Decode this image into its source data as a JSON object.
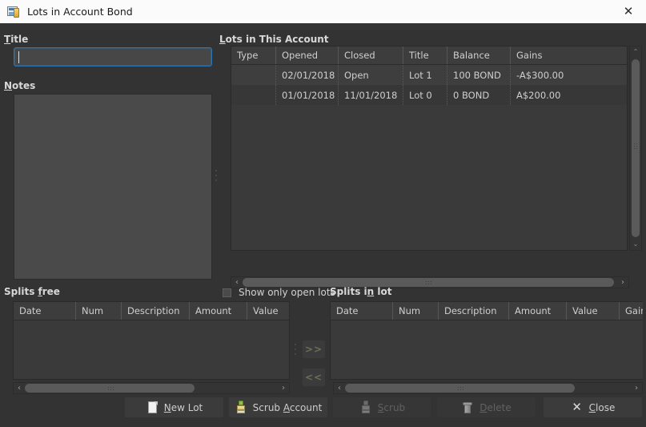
{
  "window": {
    "title": "Lots in Account Bond",
    "icon": "account-lots-icon",
    "close_label": "✕"
  },
  "left_panel": {
    "title_label": "Title",
    "title_label_accel": "T",
    "title_value": "",
    "title_placeholder": "",
    "notes_label": "Notes",
    "notes_label_accel": "N",
    "notes_value": ""
  },
  "lots_panel": {
    "label": "Lots in This Account",
    "label_accel": "L",
    "columns": [
      "Type",
      "Opened",
      "Closed",
      "Title",
      "Balance",
      "Gains"
    ],
    "rows": [
      {
        "type": "",
        "opened": "02/01/2018",
        "closed": "Open",
        "title": "Lot 1",
        "balance": "100 BOND",
        "gains": "-A$300.00"
      },
      {
        "type": "",
        "opened": "01/01/2018",
        "closed": "11/01/2018",
        "title": "Lot 0",
        "balance": "0 BOND",
        "gains": "A$200.00"
      }
    ],
    "show_only_open_lots_label": "Show only open lots",
    "show_only_open_lots_checked": false,
    "scroll_up_glyph": "⌃",
    "scroll_down_glyph": "⌄",
    "scroll_left_glyph": "‹",
    "scroll_right_glyph": "›"
  },
  "splits_free": {
    "label": "Splits free",
    "label_accel": "f",
    "columns": [
      "Date",
      "Num",
      "Description",
      "Amount",
      "Value"
    ],
    "rows": []
  },
  "splits_in_lot": {
    "label": "Splits in lot",
    "label_accel": "n",
    "columns": [
      "Date",
      "Num",
      "Description",
      "Amount",
      "Value",
      "Gain/L"
    ],
    "rows": []
  },
  "transfer_buttons": {
    "add_label": ">>",
    "remove_label": "<<"
  },
  "footer_buttons": [
    {
      "label": "New Lot",
      "accel": "N",
      "icon": "new-document-icon",
      "enabled": true
    },
    {
      "label": "Scrub Account",
      "accel": "A",
      "icon": "brush-icon",
      "enabled": true
    },
    {
      "label": "Scrub",
      "accel": "S",
      "icon": "brush-icon",
      "enabled": false
    },
    {
      "label": "Delete",
      "accel": "D",
      "icon": "trash-icon",
      "enabled": false
    },
    {
      "label": "Close",
      "accel": "C",
      "icon": "close-x-icon",
      "enabled": true
    }
  ],
  "colors": {
    "window_bg": "#333333",
    "titlebar_bg": "#fbfbfb",
    "field_bg": "#4a4a4a",
    "focus_border": "#2b76b5",
    "table_bg": "#3a3a3a",
    "text": "#d6d6d6",
    "disabled_text": "#616161"
  }
}
